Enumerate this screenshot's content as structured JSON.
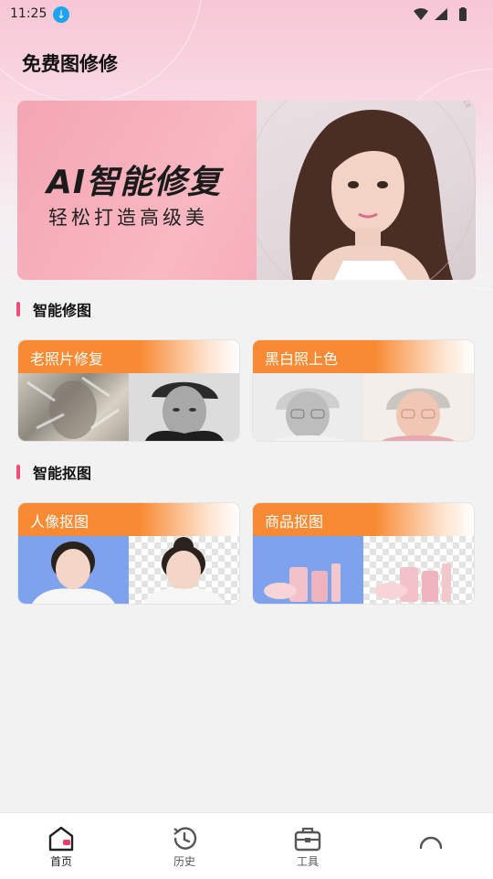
{
  "status_bar": {
    "time": "11:25"
  },
  "header": {
    "title": "免费图修修"
  },
  "banner": {
    "title": "AI智能修复",
    "subtitle": "轻松打造高级美",
    "ring_text": "HIGH QUALITY ASSURANCE"
  },
  "sections": [
    {
      "label": "智能修图",
      "cards": [
        {
          "label": "老照片修复"
        },
        {
          "label": "黑白照上色"
        }
      ]
    },
    {
      "label": "智能抠图",
      "cards": [
        {
          "label": "人像抠图"
        },
        {
          "label": "商品抠图"
        }
      ]
    }
  ],
  "bottom_nav": {
    "items": [
      {
        "label": "首页",
        "icon": "home-icon",
        "active": true
      },
      {
        "label": "历史",
        "icon": "history-icon"
      },
      {
        "label": "工具",
        "icon": "toolbox-icon"
      },
      {
        "label": "",
        "icon": "profile-icon"
      }
    ]
  },
  "colors": {
    "accent_orange": "#f88a33",
    "section_bar": "#f14b77",
    "banner_pink": "#f6a9b6"
  }
}
